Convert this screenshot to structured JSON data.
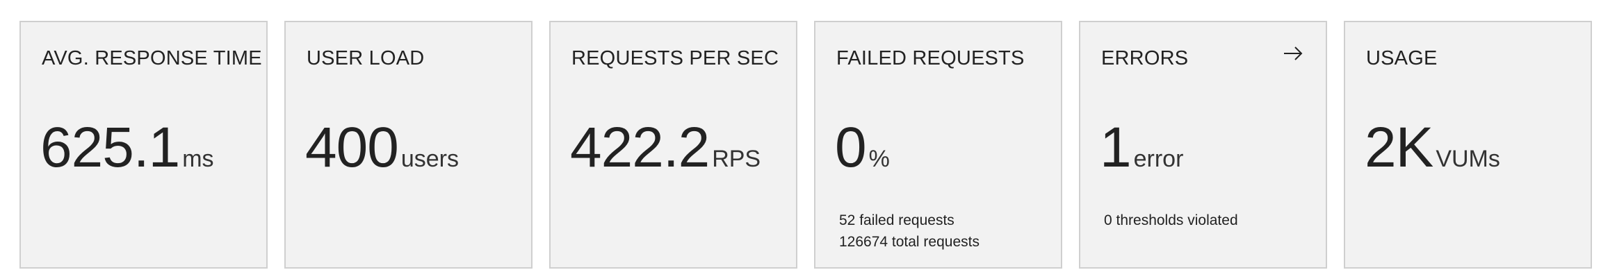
{
  "tiles": [
    {
      "title": "AVG. RESPONSE TIME",
      "value": "625.1",
      "unit": "ms"
    },
    {
      "title": "USER LOAD",
      "value": "400",
      "unit": "users"
    },
    {
      "title": "REQUESTS PER SEC",
      "value": "422.2",
      "unit": "RPS"
    },
    {
      "title": "FAILED REQUESTS",
      "value": "0",
      "unit": "%",
      "details": [
        "52 failed requests",
        "126674 total requests"
      ]
    },
    {
      "title": "ERRORS",
      "value": "1",
      "unit": "error",
      "details": [
        "0 thresholds violated"
      ],
      "icon": "arrow-right-icon"
    },
    {
      "title": "USAGE",
      "value": "2K",
      "unit": "VUMs"
    }
  ]
}
